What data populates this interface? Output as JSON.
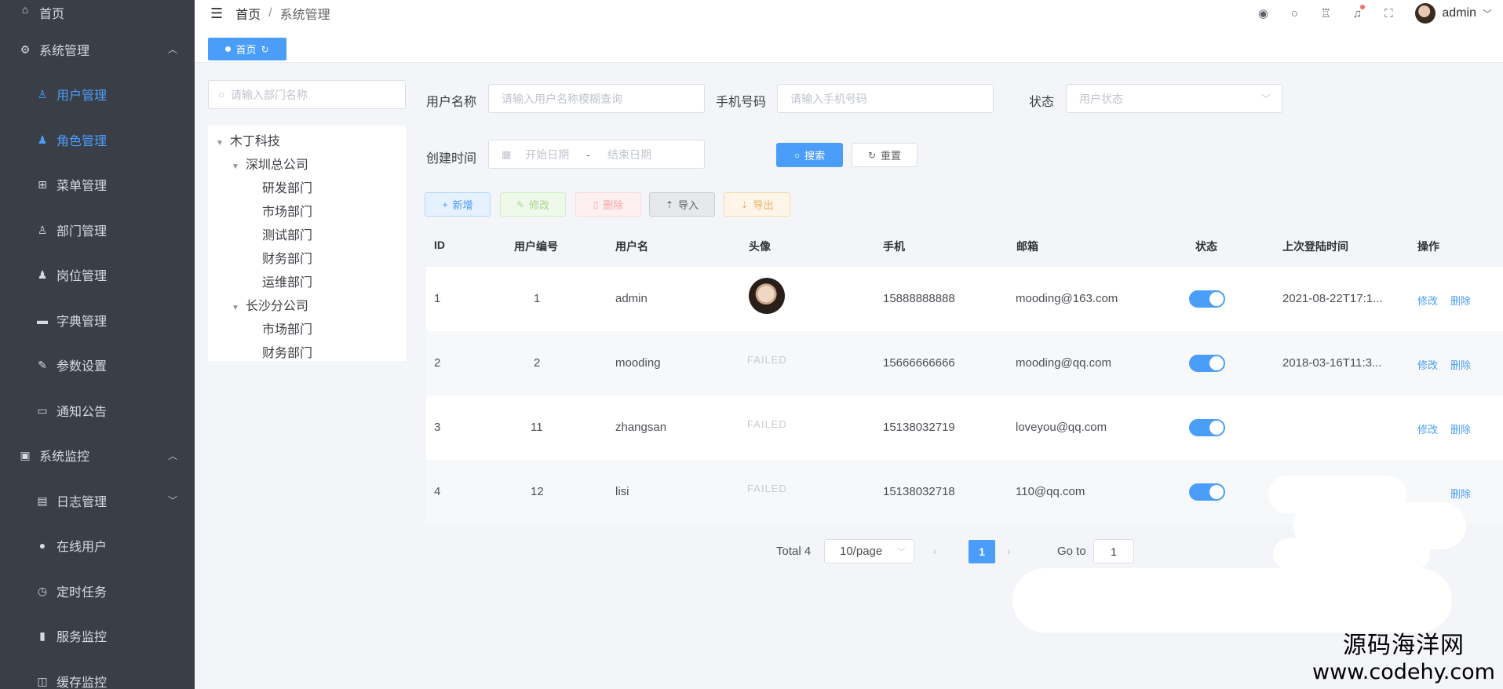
{
  "sidebar": {
    "items": [
      {
        "label": "首页",
        "icon": "home-icon",
        "type": "top"
      },
      {
        "label": "系统管理",
        "icon": "gear-icon",
        "type": "top",
        "expanded": true
      },
      {
        "label": "用户管理",
        "icon": "user-icon",
        "type": "sub",
        "active": true
      },
      {
        "label": "角色管理",
        "icon": "user-filled-icon",
        "type": "sub",
        "active": true
      },
      {
        "label": "菜单管理",
        "icon": "grid-icon",
        "type": "sub"
      },
      {
        "label": "部门管理",
        "icon": "person-icon",
        "type": "sub"
      },
      {
        "label": "岗位管理",
        "icon": "post-icon",
        "type": "sub"
      },
      {
        "label": "字典管理",
        "icon": "ticket-icon",
        "type": "sub"
      },
      {
        "label": "参数设置",
        "icon": "edit-icon",
        "type": "sub"
      },
      {
        "label": "通知公告",
        "icon": "message-icon",
        "type": "sub"
      },
      {
        "label": "系统监控",
        "icon": "monitor-icon",
        "type": "top",
        "expanded": true
      },
      {
        "label": "日志管理",
        "icon": "document-icon",
        "type": "sub",
        "chevron": "down"
      },
      {
        "label": "在线用户",
        "icon": "warning-icon",
        "type": "sub"
      },
      {
        "label": "定时任务",
        "icon": "clock-icon",
        "type": "sub"
      },
      {
        "label": "服务监控",
        "icon": "bar-chart-icon",
        "type": "sub"
      },
      {
        "label": "缓存监控",
        "icon": "cache-icon",
        "type": "sub"
      }
    ]
  },
  "header": {
    "breadcrumb": [
      "首页",
      "系统管理"
    ],
    "username": "admin"
  },
  "tags": [
    {
      "label": "首页"
    }
  ],
  "dept": {
    "search_placeholder": "请输入部门名称",
    "root": "木丁科技",
    "branch1": "深圳总公司",
    "branch1_children": [
      "研发部门",
      "市场部门",
      "测试部门",
      "财务部门",
      "运维部门"
    ],
    "branch2": "长沙分公司",
    "branch2_children": [
      "市场部门",
      "财务部门"
    ]
  },
  "search": {
    "username_label": "用户名称",
    "username_placeholder": "请输入用户名称模糊查询",
    "phone_label": "手机号码",
    "phone_placeholder": "请输入手机号码",
    "status_label": "状态",
    "status_placeholder": "用户状态",
    "created_label": "创建时间",
    "start_placeholder": "开始日期",
    "end_placeholder": "结束日期",
    "date_sep": "-",
    "search_button": "搜索",
    "reset_button": "重置"
  },
  "toolbar": {
    "add": "新增",
    "edit": "修改",
    "delete": "删除",
    "import": "导入",
    "export": "导出"
  },
  "table": {
    "columns": [
      "ID",
      "用户编号",
      "用户名",
      "头像",
      "手机",
      "邮箱",
      "状态",
      "上次登陆时间",
      "操作"
    ],
    "rows": [
      {
        "id": "1",
        "no": "1",
        "name": "admin",
        "avatar": "image",
        "phone": "15888888888",
        "email": "mooding@163.com",
        "status": true,
        "last_login": "2021-08-22T17:1...",
        "edit": "修改",
        "delete": "删除"
      },
      {
        "id": "2",
        "no": "2",
        "name": "mooding",
        "avatar": "FAILED",
        "phone": "15666666666",
        "email": "mooding@qq.com",
        "status": true,
        "last_login": "2018-03-16T11:3...",
        "edit": "修改",
        "delete": "删除"
      },
      {
        "id": "3",
        "no": "11",
        "name": "zhangsan",
        "avatar": "FAILED",
        "phone": "15138032719",
        "email": "loveyou@qq.com",
        "status": true,
        "last_login": "",
        "edit": "修改",
        "delete": "删除"
      },
      {
        "id": "4",
        "no": "12",
        "name": "lisi",
        "avatar": "FAILED",
        "phone": "15138032718",
        "email": "110@qq.com",
        "status": true,
        "last_login": "",
        "edit": "",
        "delete": "删除"
      }
    ]
  },
  "pagination": {
    "total": "Total 4",
    "page_size": "10/page",
    "current": "1",
    "goto_label": "Go to",
    "goto_value": "1"
  },
  "watermark": {
    "line1": "源码海洋网",
    "line2": "www.codehy.com"
  },
  "colors": {
    "sidebar_bg": "#3a3e47",
    "accent": "#4a9df8"
  }
}
